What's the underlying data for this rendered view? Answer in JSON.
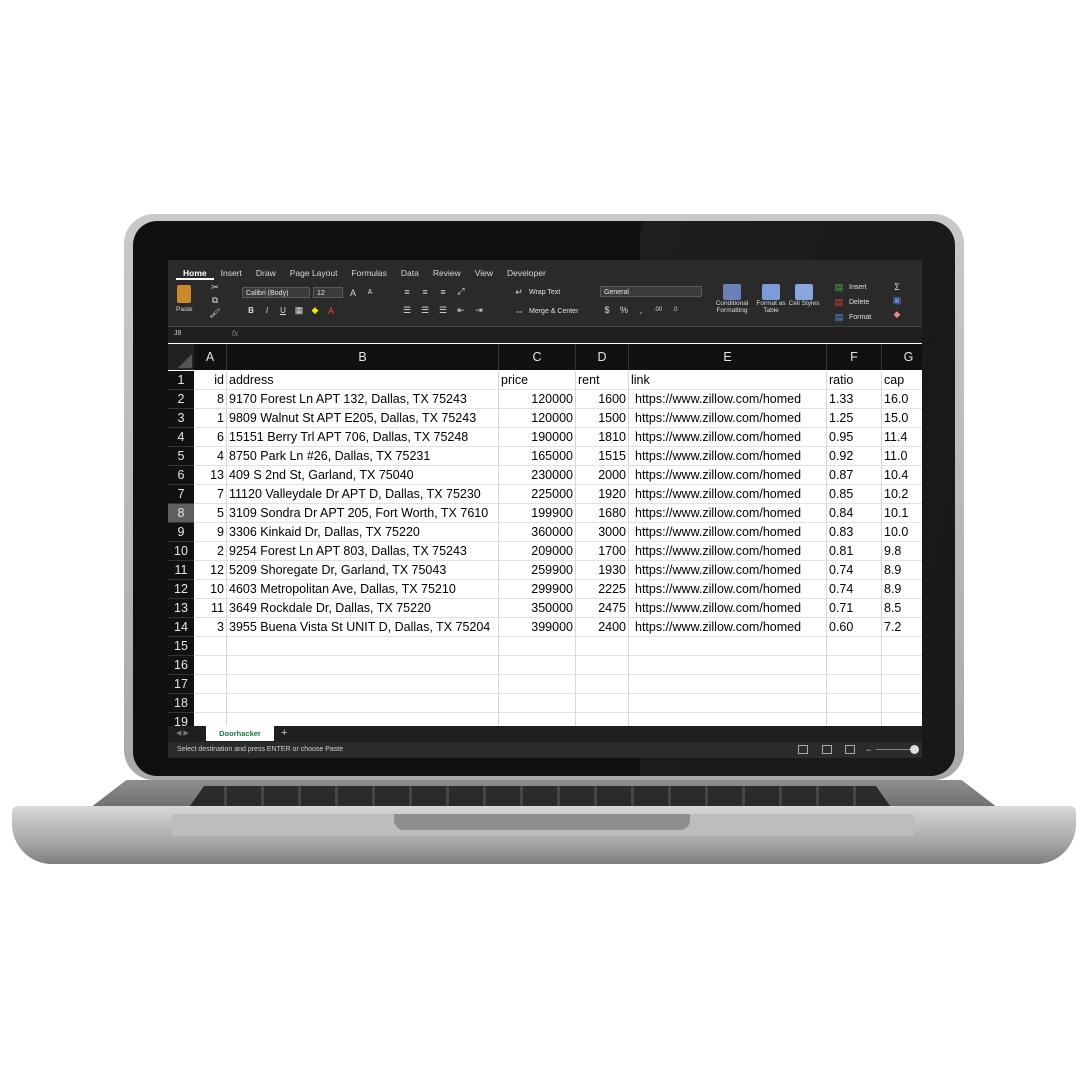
{
  "ribbon": {
    "tabs": [
      "Home",
      "Insert",
      "Draw",
      "Page Layout",
      "Formulas",
      "Data",
      "Review",
      "View",
      "Developer"
    ],
    "paste_label": "Paste",
    "font_name": "Calibri (Body)",
    "font_size": "12",
    "wrap_text": "Wrap Text",
    "merge_center": "Merge & Center",
    "number_format": "General",
    "conditional_formatting": "Conditional Formatting",
    "format_as_table": "Format as Table",
    "cell_styles": "Cell Styles",
    "insert": "Insert",
    "delete": "Delete",
    "format": "Format"
  },
  "formula_bar": {
    "name_box": "J8",
    "fx": "fx"
  },
  "grid": {
    "columns": [
      "A",
      "B",
      "C",
      "D",
      "E",
      "F",
      "G"
    ],
    "header_row": [
      "id",
      "address",
      "price",
      "rent",
      "link",
      "ratio",
      "cap"
    ],
    "rows": [
      [
        "8",
        "9170 Forest Ln APT 132, Dallas, TX 75243",
        "120000",
        "1600",
        "https://www.zillow.com/homed",
        "1.33",
        "16.0"
      ],
      [
        "1",
        "9809 Walnut St APT E205, Dallas, TX 75243",
        "120000",
        "1500",
        "https://www.zillow.com/homed",
        "1.25",
        "15.0"
      ],
      [
        "6",
        "15151 Berry Trl APT 706, Dallas, TX 75248",
        "190000",
        "1810",
        "https://www.zillow.com/homed",
        "0.95",
        "11.4"
      ],
      [
        "4",
        "8750 Park Ln #26, Dallas, TX 75231",
        "165000",
        "1515",
        "https://www.zillow.com/homed",
        "0.92",
        "11.0"
      ],
      [
        "13",
        "409 S 2nd St, Garland, TX 75040",
        "230000",
        "2000",
        "https://www.zillow.com/homed",
        "0.87",
        "10.4"
      ],
      [
        "7",
        "11120 Valleydale Dr APT D, Dallas, TX 75230",
        "225000",
        "1920",
        "https://www.zillow.com/homed",
        "0.85",
        "10.2"
      ],
      [
        "5",
        "3109 Sondra Dr APT 205, Fort Worth, TX 7610",
        "199900",
        "1680",
        "https://www.zillow.com/homed",
        "0.84",
        "10.1"
      ],
      [
        "9",
        "3306 Kinkaid Dr, Dallas, TX 75220",
        "360000",
        "3000",
        "https://www.zillow.com/homed",
        "0.83",
        "10.0"
      ],
      [
        "2",
        "9254 Forest Ln APT 803, Dallas, TX 75243",
        "209000",
        "1700",
        "https://www.zillow.com/homed",
        "0.81",
        "9.8"
      ],
      [
        "12",
        "5209 Shoregate Dr, Garland, TX 75043",
        "259900",
        "1930",
        "https://www.zillow.com/homed",
        "0.74",
        "8.9"
      ],
      [
        "10",
        "4603 Metropolitan Ave, Dallas, TX 75210",
        "299900",
        "2225",
        "https://www.zillow.com/homed",
        "0.74",
        "8.9"
      ],
      [
        "11",
        "3649 Rockdale Dr, Dallas, TX 75220",
        "350000",
        "2475",
        "https://www.zillow.com/homed",
        "0.71",
        "8.5"
      ],
      [
        "3",
        "3955 Buena Vista St UNIT D, Dallas, TX 75204",
        "399000",
        "2400",
        "https://www.zillow.com/homed",
        "0.60",
        "7.2"
      ]
    ],
    "row_numbers": [
      "1",
      "2",
      "3",
      "4",
      "5",
      "6",
      "7",
      "8",
      "9",
      "10",
      "11",
      "12",
      "13",
      "14",
      "15",
      "16",
      "17",
      "18",
      "19"
    ],
    "selected_row": "8"
  },
  "sheet": {
    "tab_name": "Doorhacker",
    "add_label": "+"
  },
  "status": {
    "message": "Select destination and press ENTER or choose Paste"
  }
}
